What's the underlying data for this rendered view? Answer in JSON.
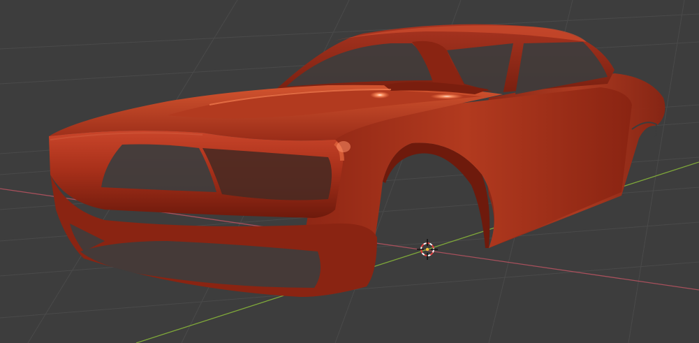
{
  "viewport": {
    "background": "#3d3d3d",
    "grid_color": "#4a4a4a",
    "x_axis_color": "#a8505c",
    "y_axis_color": "#7fa83a",
    "grid": true
  },
  "object": {
    "name": "car-body-shell",
    "shading": "solid-glossy",
    "color": "#b8341a",
    "highlight_color": "#ff7a4a",
    "shadow_color": "#5a1408"
  },
  "cursor": {
    "icon": "3d-cursor-icon",
    "ring_colors": [
      "#e23b3b",
      "#ffffff"
    ]
  }
}
